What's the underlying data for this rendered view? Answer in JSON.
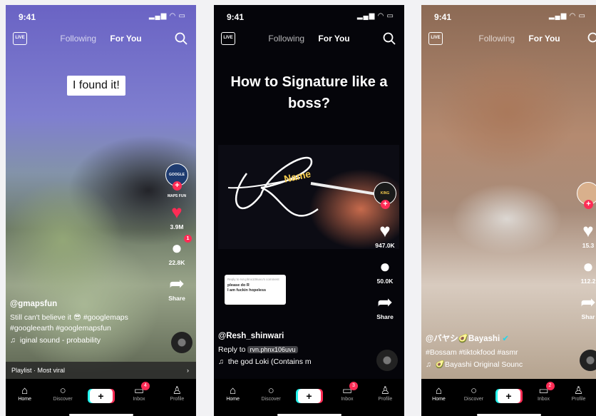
{
  "screens": [
    {
      "status_time": "9:41",
      "nav": {
        "live": "LIVE",
        "following": "Following",
        "for_you": "For You"
      },
      "overlay_caption": "I found it!",
      "likes": "3.9M",
      "comments": "22.8K",
      "comments_badge": "1",
      "share": "Share",
      "username": "@gmapsfun",
      "caption_line1": "Still can't believe it 😎 #googlemaps",
      "caption_line2": "#googleearth #googlemapsfun",
      "sound": "iginal sound - probability",
      "playlist": "Playlist · Most viral",
      "inbox_badge": "4",
      "avatar_text": "GOOGLE MAPS FUN"
    },
    {
      "status_time": "9:41",
      "nav": {
        "live": "LIVE",
        "following": "Following",
        "for_you": "For You"
      },
      "title": "How to Signature like a boss?",
      "signature_name": "Name",
      "comment_card": {
        "lead": "Reply to rvn.phnx106uvu's comment",
        "line1": "please do R",
        "line2": "I am fuckin hopeless"
      },
      "likes": "947.0K",
      "comments": "50.0K",
      "share": "Share",
      "username": "@Resh_shinwari",
      "reply_to_label": "Reply to",
      "reply_to_handle": "rvn.phnx106uvu",
      "sound": "the god Loki (Contains m",
      "inbox_badge": "3",
      "avatar_text": "KING"
    },
    {
      "status_time": "9:41",
      "nav": {
        "live": "LIVE",
        "following": "Following",
        "for_you": "For You"
      },
      "likes": "15.3",
      "comments": "112.2",
      "share": "Shar",
      "username": "@バヤシ🥑Bayashi",
      "caption": "#Bossam #tiktokfood #asmr",
      "sound": "🥑Bayashi Original Sounc",
      "inbox_badge": "2"
    }
  ],
  "tabbar": {
    "home": "Home",
    "discover": "Discover",
    "inbox": "Inbox",
    "profile": "Profile"
  }
}
